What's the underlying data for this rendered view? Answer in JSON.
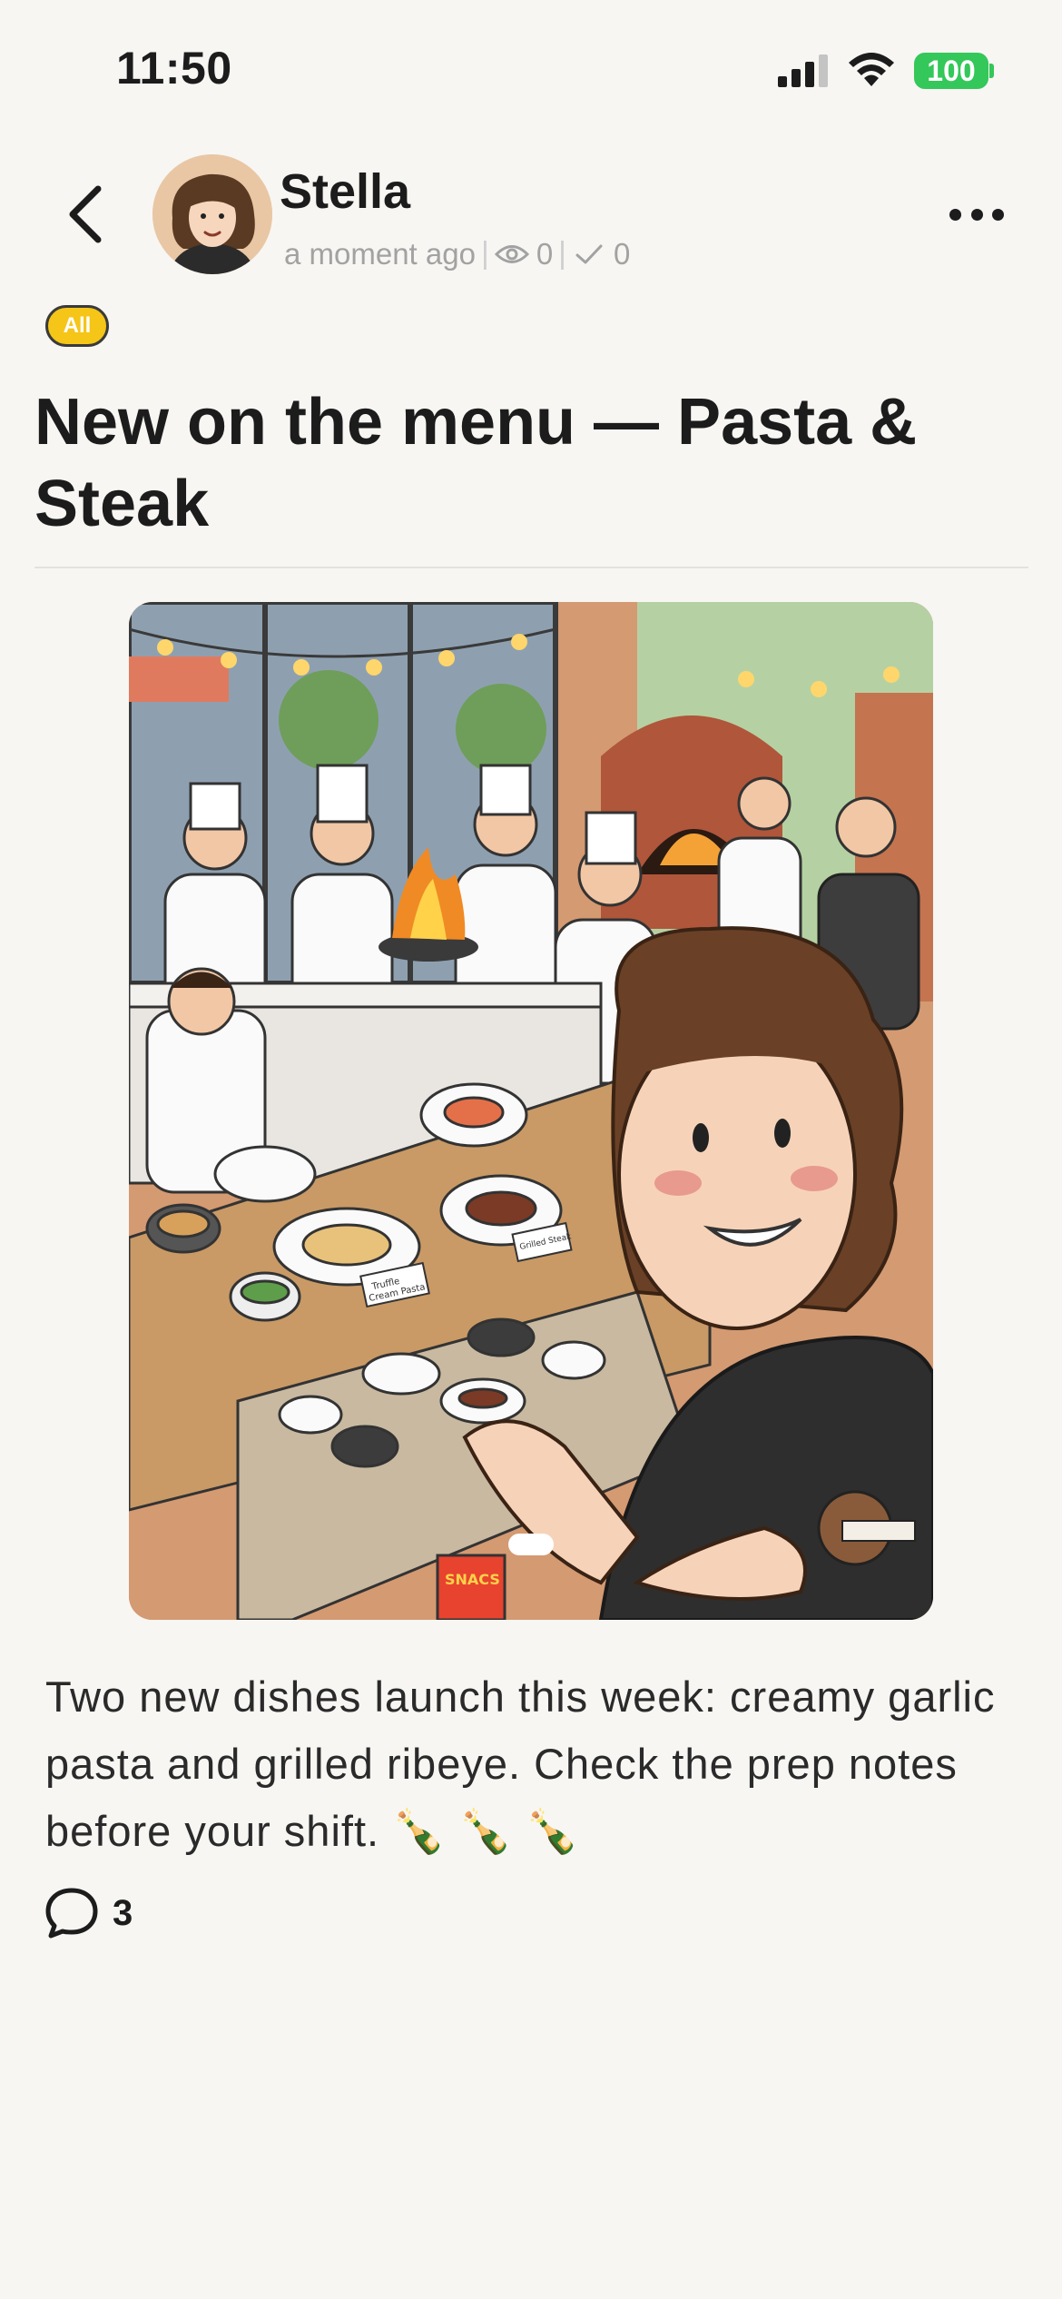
{
  "status_bar": {
    "time": "11:50",
    "battery": "100"
  },
  "author": {
    "name": "Stella",
    "timestamp": "a moment ago",
    "views": "0",
    "checks": "0"
  },
  "tag": "All",
  "post": {
    "title": "New on the menu — Pasta & Steak",
    "body": "Two new dishes launch this week: creamy garlic pasta and grilled ribeye. Check the prep notes before your shift. 🍾 🍾 🍾",
    "comments": "3"
  },
  "image": {
    "table_labels": [
      "Truffle Cream Pasta",
      "Grilled Steak"
    ],
    "chip_bag": "SNACS"
  },
  "icons": {
    "back": "chevron-left-icon",
    "more": "ellipsis-icon",
    "views": "eye-icon",
    "checks": "checkmark-icon",
    "comment": "speech-bubble-icon"
  },
  "colors": {
    "badge": "#f5c518",
    "battery": "#34c759",
    "background": "#f7f6f3"
  }
}
